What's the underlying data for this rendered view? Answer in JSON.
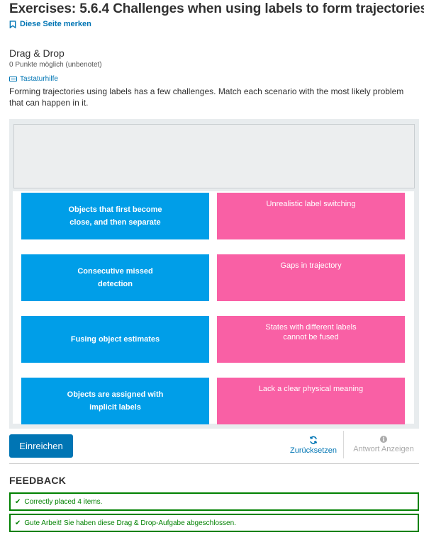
{
  "page": {
    "title": "Exercises: 5.6.4 Challenges when using labels to form trajectories",
    "bookmark_label": "Diese Seite merken"
  },
  "problem": {
    "title": "Drag & Drop",
    "points": "0 Punkte möglich (unbenotet)",
    "keyboard_help": "Tastaturhilfe",
    "prompt": "Forming trajectories using labels has a few challenges. Match each scenario with the most likely problem that can happen in it."
  },
  "colors": {
    "accent": "#0075b4",
    "item_blue": "#009ee8",
    "item_pink": "#f960a5",
    "success": "#008100"
  },
  "dnd": {
    "items": [
      {
        "label": "Objects that first become close, and then separate"
      },
      {
        "label": "Consecutive missed detection"
      },
      {
        "label": "Fusing object estimates"
      },
      {
        "label": "Objects are assigned with implicit labels"
      }
    ],
    "targets": [
      {
        "label": "Unrealistic label switching"
      },
      {
        "label": "Gaps in trajectory"
      },
      {
        "label": "States with different labels cannot be fused"
      },
      {
        "label": "Lack a clear physical meaning"
      }
    ]
  },
  "actions": {
    "submit_label": "Einreichen",
    "reset_label": "Zurücksetzen",
    "show_answer_label": "Antwort Anzeigen",
    "reset_icon": "refresh-icon",
    "show_answer_icon": "info-icon"
  },
  "feedback": {
    "title": "FEEDBACK",
    "messages": [
      "Correctly placed 4 items.",
      "Gute Arbeit! Sie haben diese Drag & Drop-Aufgabe abgeschlossen."
    ]
  }
}
